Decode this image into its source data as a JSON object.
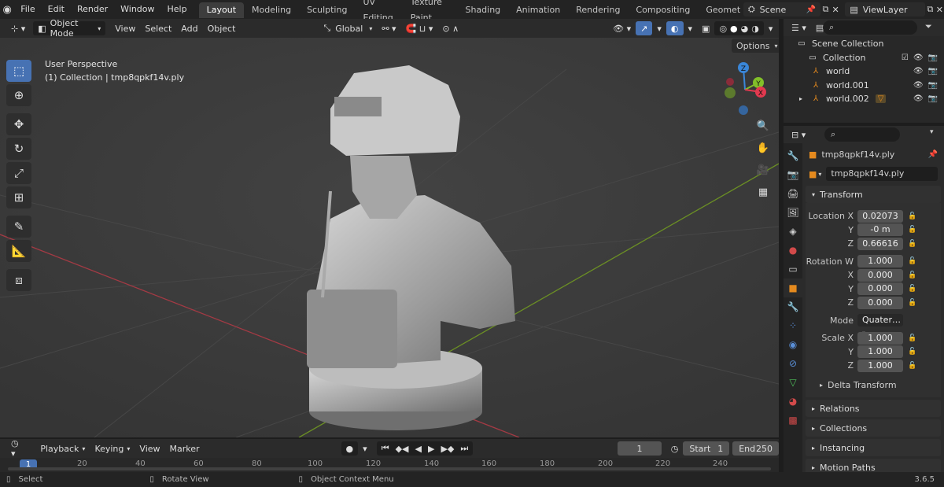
{
  "topbar": {
    "menus": [
      "File",
      "Edit",
      "Render",
      "Window",
      "Help"
    ],
    "workspaces": [
      "Layout",
      "Modeling",
      "Sculpting",
      "UV Editing",
      "Texture Paint",
      "Shading",
      "Animation",
      "Rendering",
      "Compositing",
      "Geometry Noc"
    ],
    "active_workspace": "Layout",
    "scene": "Scene",
    "view_layer": "ViewLayer"
  },
  "viewport_header": {
    "mode": "Object Mode",
    "menus": [
      "View",
      "Select",
      "Add",
      "Object"
    ],
    "transform_orientation": "Global",
    "options_label": "Options"
  },
  "viewport": {
    "perspective": "User Perspective",
    "collection_info": "(1) Collection | tmp8qpkf14v.ply",
    "gizmo_labels": {
      "z": "Z",
      "y": "Y",
      "x": "X"
    }
  },
  "timeline": {
    "menus": [
      "Playback",
      "Keying",
      "View",
      "Marker"
    ],
    "current_frame": "1",
    "start_label": "Start",
    "start": "1",
    "end_label": "End",
    "end": "250",
    "ruler": [
      "1",
      "20",
      "40",
      "60",
      "80",
      "100",
      "120",
      "140",
      "160",
      "180",
      "200",
      "220",
      "240"
    ]
  },
  "statusbar": {
    "select": "Select",
    "rotate": "Rotate View",
    "context": "Object Context Menu",
    "version": "3.6.5"
  },
  "outliner": {
    "rows": [
      {
        "label": "Scene Collection"
      },
      {
        "label": "Collection"
      },
      {
        "label": "world"
      },
      {
        "label": "world.001"
      },
      {
        "label": "world.002"
      }
    ]
  },
  "properties": {
    "object_name": "tmp8qpkf14v.ply",
    "data_name": "tmp8qpkf14v.ply",
    "transform_label": "Transform",
    "location": {
      "label": "Location X",
      "y_label": "Y",
      "z_label": "Z",
      "x": "0.02073",
      "y": "-0 m",
      "z": "0.66616"
    },
    "rotation": {
      "label": "Rotation W",
      "x_label": "X",
      "y_label": "Y",
      "z_label": "Z",
      "w": "1.000",
      "x": "0.000",
      "y": "0.000",
      "z": "0.000"
    },
    "mode_label": "Mode",
    "mode_value": "Quater…",
    "scale": {
      "label": "Scale X",
      "y_label": "Y",
      "z_label": "Z",
      "x": "1.000",
      "y": "1.000",
      "z": "1.000"
    },
    "panels": [
      "Delta Transform",
      "Relations",
      "Collections",
      "Instancing",
      "Motion Paths"
    ]
  },
  "colors": {
    "accent": "#4772b3",
    "axis_x": "#e2394f",
    "axis_y": "#82bf29",
    "axis_z": "#3a86d8",
    "orange": "#e58a1e"
  }
}
